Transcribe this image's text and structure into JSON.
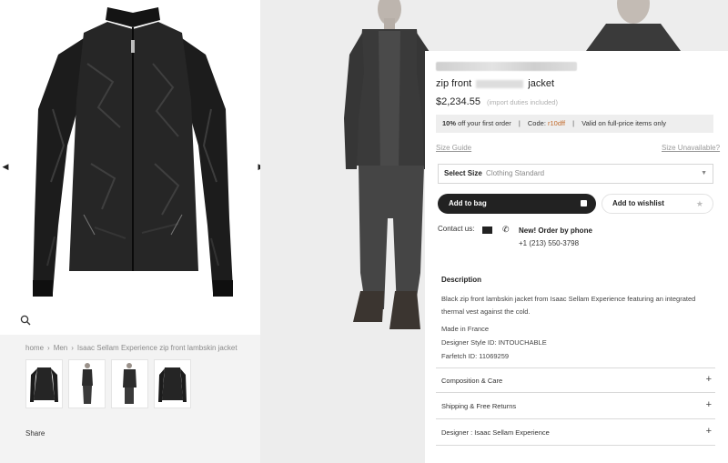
{
  "breadcrumb": {
    "home": "home",
    "men": "Men",
    "current": "Isaac Sellam Experience zip front lambskin jacket",
    "separator": "›"
  },
  "gallery": {
    "prev_icon": "chevron-left-icon",
    "next_icon": "chevron-right-icon",
    "zoom_icon": "magnifier-icon",
    "thumbnails": [
      "front",
      "model-front",
      "model-side",
      "back"
    ]
  },
  "share_label": "Share",
  "product": {
    "title_prefix": "zip front",
    "title_suffix": "jacket",
    "price": "$2,234.55",
    "duties_note": "(import duties included)"
  },
  "promo": {
    "offer": "10%",
    "offer_text": "off your first order",
    "code_label": "Code:",
    "code": "r10dff",
    "validity": "Valid on full-price items only"
  },
  "size": {
    "guide": "Size Guide",
    "unavailable": "Size Unavailable?",
    "select_label": "Select Size",
    "standard": "Clothing Standard"
  },
  "actions": {
    "add_to_bag": "Add to bag",
    "add_to_wishlist": "Add to wishlist"
  },
  "contact": {
    "label": "Contact us:",
    "phone_title": "New! Order by phone",
    "phone_number": "+1 (213) 550-3798"
  },
  "description": {
    "heading": "Description",
    "text": "Black zip front lambskin jacket from Isaac Sellam Experience featuring an integrated thermal vest against the cold.",
    "made_in": "Made in France",
    "style_id": "Designer Style ID: INTOUCHABLE",
    "farfetch_id": "Farfetch ID: 11069259"
  },
  "accordion": {
    "composition": "Composition & Care",
    "shipping": "Shipping & Free Returns",
    "designer": "Designer : Isaac Sellam Experience",
    "icon": "+"
  },
  "colors": {
    "accent_code": "#c26a2a",
    "button_dark": "#222222"
  }
}
